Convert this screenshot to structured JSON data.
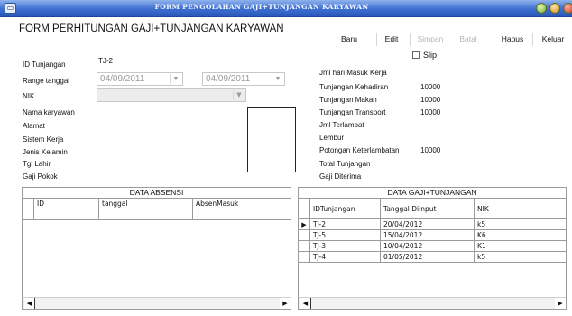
{
  "window": {
    "title": "FORM PENGOLAHAN GAJI+TUNJANGAN KARYAWAN",
    "system_icon": "window-menu-icon"
  },
  "form_header": "FORM PERHITUNGAN GAJI+TUNJANGAN KARYAWAN",
  "toolbar": {
    "baru": "Baru",
    "edit": "Edit",
    "simpan": "Simpan",
    "batal": "Batal",
    "hapus": "Hapus",
    "keluar": "Keluar"
  },
  "slip": {
    "label": "Slip",
    "checked": false
  },
  "left_form": {
    "id_tunjangan_label": "ID Tunjangan",
    "id_tunjangan_value": "TJ-2",
    "range_tanggal_label": "Range tanggal",
    "date_from": "04/09/2011",
    "date_to": "04/09/2011",
    "nik_label": "NIK",
    "nik_value": "",
    "nama_label": "Nama karyawan",
    "alamat_label": "Alamat",
    "sistem_kerja_label": "Sistem Kerja",
    "jenis_kelamin_label": "Jenis Kelamin",
    "tgl_lahir_label": "Tgl Lahir",
    "gaji_pokok_label": "Gaji Pokok"
  },
  "right_form": {
    "jml_hari_label": "Jml hari Masuk Kerja",
    "jml_hari_value": "",
    "tunj_kehadiran_label": "Tunjangan Kehadiran",
    "tunj_kehadiran_value": "10000",
    "tunj_makan_label": "Tunjangan Makan",
    "tunj_makan_value": "10000",
    "tunj_transport_label": "Tunjangan Transport",
    "tunj_transport_value": "10000",
    "jml_terlambat_label": "Jml Terlambat",
    "lembur_label": "Lembur",
    "potongan_label": "Potongan Keterlambatan",
    "potongan_value": "10000",
    "total_tunjangan_label": "Total Tunjangan",
    "gaji_diterima_label": "Gaji Diterima"
  },
  "absensi_grid": {
    "caption": "DATA ABSENSI",
    "columns": [
      "ID",
      "tanggal",
      "AbsenMasuk"
    ]
  },
  "gaji_grid": {
    "caption": "DATA GAJI+TUNJANGAN",
    "columns": [
      "IDTunjangan",
      "Tanggal Diinput",
      "NIK"
    ],
    "rows": [
      [
        "TJ-2",
        "20/04/2012",
        "k5"
      ],
      [
        "TJ-5",
        "15/04/2012",
        "K6"
      ],
      [
        "TJ-3",
        "10/04/2012",
        "K1"
      ],
      [
        "TJ-4",
        "01/05/2012",
        "k5"
      ]
    ],
    "current_row_indicator": "▶"
  },
  "icons": {
    "dropdown": "▼",
    "scroll_left": "◀",
    "scroll_right": "▶"
  }
}
